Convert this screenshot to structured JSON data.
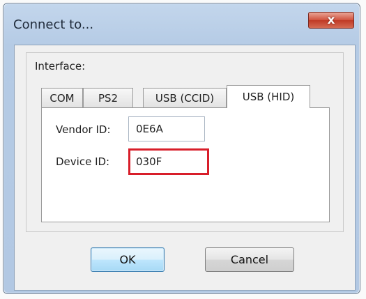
{
  "window": {
    "title": "Connect to...",
    "close_glyph": "x"
  },
  "interface": {
    "label": "Interface:",
    "tabs": [
      {
        "label": "COM",
        "active": false
      },
      {
        "label": "PS2",
        "active": false
      },
      {
        "label": "USB (CCID)",
        "active": false
      },
      {
        "label": "USB (HID)",
        "active": true
      }
    ]
  },
  "fields": {
    "vendor_id": {
      "label": "Vendor ID:",
      "value": "0E6A"
    },
    "device_id": {
      "label": "Device ID:",
      "value": "030F",
      "highlighted": true,
      "highlight_color": "#d81e2a"
    }
  },
  "buttons": {
    "ok": "OK",
    "cancel": "Cancel"
  },
  "colors": {
    "accent": "#3c7fb1",
    "close_button": "#c03a26",
    "highlight": "#d81e2a"
  }
}
